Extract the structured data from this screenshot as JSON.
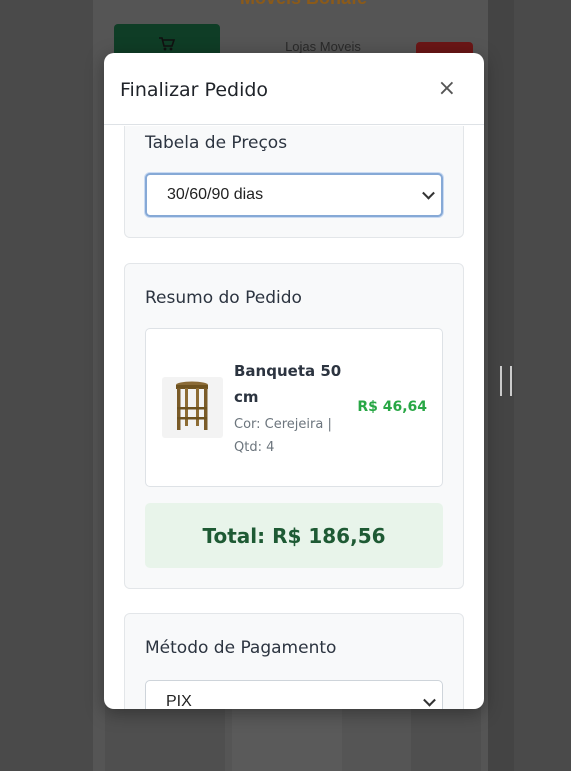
{
  "background": {
    "brand": "Moveis Bonafe",
    "store_label": "Lojas Moveis"
  },
  "modal": {
    "title": "Finalizar Pedido",
    "close_label": "×"
  },
  "price_table": {
    "title": "Tabela de Preços",
    "selected": "30/60/90 dias"
  },
  "summary": {
    "title": "Resumo do Pedido",
    "items": [
      {
        "name": "Banqueta 50 cm",
        "meta": "Cor: Cerejeira | Qtd: 4",
        "price": "R$ 46,64"
      }
    ],
    "total": "Total: R$ 186,56"
  },
  "payment": {
    "title": "Método de Pagamento",
    "selected": "PIX"
  },
  "colors": {
    "accent_green": "#28a745",
    "total_bg": "#e8f4ea",
    "total_text": "#1e5a34"
  }
}
